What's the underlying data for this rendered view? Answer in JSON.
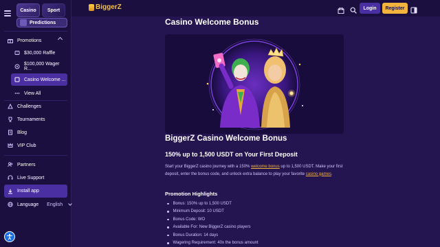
{
  "sidebar": {
    "tabs": {
      "casino": "Casino",
      "sport": "Sport"
    },
    "predictions": "Predictions",
    "promotions": {
      "label": "Promotions",
      "items": [
        {
          "label": "$30,000 Raffle"
        },
        {
          "label": "$100,000 Wager R..."
        },
        {
          "label": "Casino Welcome ..."
        },
        {
          "label": "View All"
        }
      ]
    },
    "nav": [
      {
        "label": "Challenges"
      },
      {
        "label": "Tournaments"
      },
      {
        "label": "Blog"
      },
      {
        "label": "VIP Club"
      }
    ],
    "nav2": [
      {
        "label": "Partners"
      },
      {
        "label": "Live Support"
      }
    ],
    "install": "Install app",
    "language": {
      "label": "Language",
      "value": "English"
    }
  },
  "header": {
    "logo": "BiggerZ",
    "login": "Login",
    "register": "Register"
  },
  "main": {
    "page_title": "Casino Welcome Bonus",
    "heading": "BiggerZ Casino Welcome Bonus",
    "subheading": "150% up to 1,500 USDT on Your First Deposit",
    "intro": {
      "part1": "Start your BiggerZ casino journey with a 150% ",
      "link1": "welcome bonus",
      "part2": " up to 1,500 USDT. Make your first deposit, enter the bonus code, and unlock extra balance to play your favorite ",
      "link2": "casino games",
      "part3": "."
    },
    "highlights_title": "Promotion Highlights",
    "highlights": [
      "Bonus: 150% up to 1,500 USDT",
      "Minimum Deposit: 10 USDT",
      "Bonus Code: WO",
      "Available For: New BiggerZ casino players",
      "Bonus Duration: 14 days",
      "Wagering Requirement: 40x the bonus amount"
    ]
  },
  "colors": {
    "accent": "#4a2fa3",
    "register": "#f2b43c",
    "background": "#24144f",
    "sidebar": "#1a0f3f"
  }
}
